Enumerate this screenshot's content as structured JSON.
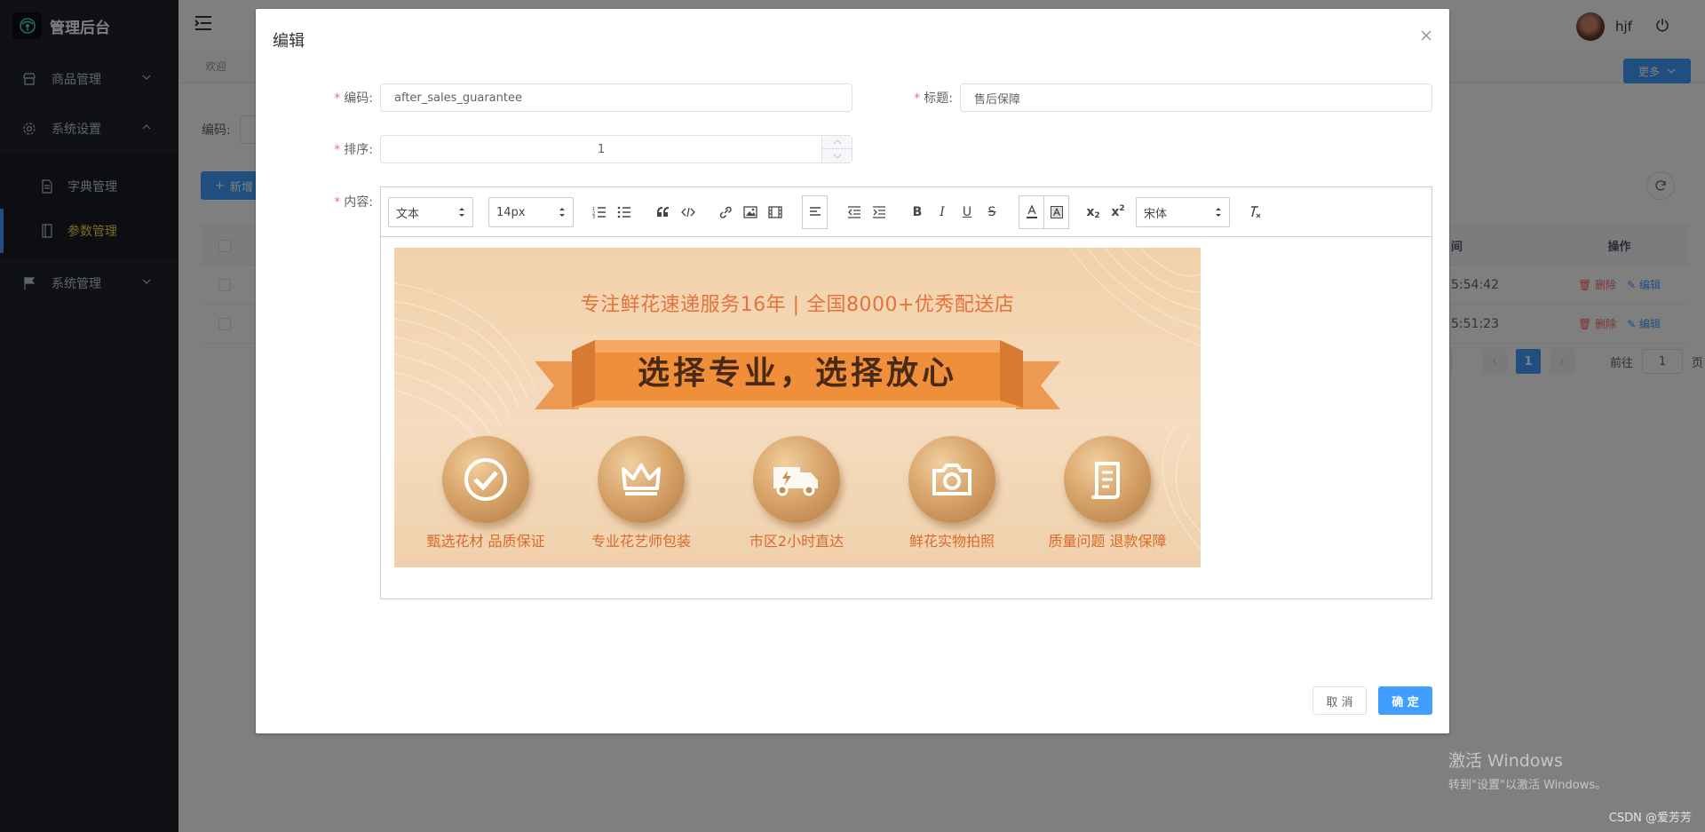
{
  "app": {
    "title": "管理后台"
  },
  "sidebar": {
    "items": [
      {
        "label": "商品管理",
        "icon": "shop-icon",
        "expanded": false
      },
      {
        "label": "系统设置",
        "icon": "gear-icon",
        "expanded": true,
        "children": [
          {
            "label": "字典管理",
            "icon": "document-icon",
            "active": false
          },
          {
            "label": "参数管理",
            "icon": "notebook-icon",
            "active": true
          }
        ]
      },
      {
        "label": "系统管理",
        "icon": "flag-icon",
        "expanded": false
      }
    ]
  },
  "header": {
    "username": "hjf"
  },
  "tags": {
    "items": [
      "欢迎"
    ],
    "more_label": "更多"
  },
  "search": {
    "code_label": "编码:"
  },
  "toolbar": {
    "add_label": "新增"
  },
  "table": {
    "ops_header": "操作",
    "time_col_suffix": "间",
    "rows": [
      {
        "time": "5:54:42",
        "delete": "删除",
        "edit": "编辑"
      },
      {
        "time": "5:51:23",
        "delete": "删除",
        "edit": "编辑"
      }
    ]
  },
  "pagination": {
    "current_page": "1",
    "goto_label": "前往",
    "goto_value": "1",
    "page_suffix": "页"
  },
  "dialog": {
    "title": "编辑",
    "fields": {
      "code": {
        "label": "编码:",
        "value": "after_sales_guarantee",
        "required": true
      },
      "title": {
        "label": "标题:",
        "value": "售后保障",
        "required": true
      },
      "sort": {
        "label": "排序:",
        "value": "1",
        "required": true
      },
      "content": {
        "label": "内容:",
        "required": true
      }
    },
    "editor": {
      "format_select": "文本",
      "size_select": "14px",
      "font_select": "宋体",
      "buttons": [
        "ordered-list",
        "bullet-list",
        "blockquote",
        "code",
        "link",
        "image",
        "video",
        "align",
        "outdent",
        "indent",
        "bold",
        "italic",
        "underline",
        "strike",
        "color",
        "background",
        "subscript",
        "superscript",
        "clean"
      ],
      "banner": {
        "top_line": "专注鲜花速递服务16年   |   全国8000+优秀配送店",
        "ribbon_text": "选择专业，选择放心",
        "features": [
          {
            "caption": "甄选花材 品质保证",
            "icon": "check-icon"
          },
          {
            "caption": "专业花艺师包装",
            "icon": "crown-icon"
          },
          {
            "caption": "市区2小时直达",
            "icon": "truck-icon"
          },
          {
            "caption": "鲜花实物拍照",
            "icon": "camera-icon"
          },
          {
            "caption": "质量问题 退款保障",
            "icon": "receipt-icon"
          }
        ]
      }
    },
    "cancel_label": "取 消",
    "confirm_label": "确 定"
  },
  "watermark": {
    "windows_line1": "激活 Windows",
    "windows_line2": "转到\"设置\"以激活 Windows。",
    "csdn": "CSDN @爱芳芳"
  },
  "colors": {
    "primary": "#409eff",
    "sidebar_bg": "#1e222b",
    "active_menu": "#ffd04b",
    "danger": "#f56c6c",
    "banner_text": "#e4733b"
  }
}
